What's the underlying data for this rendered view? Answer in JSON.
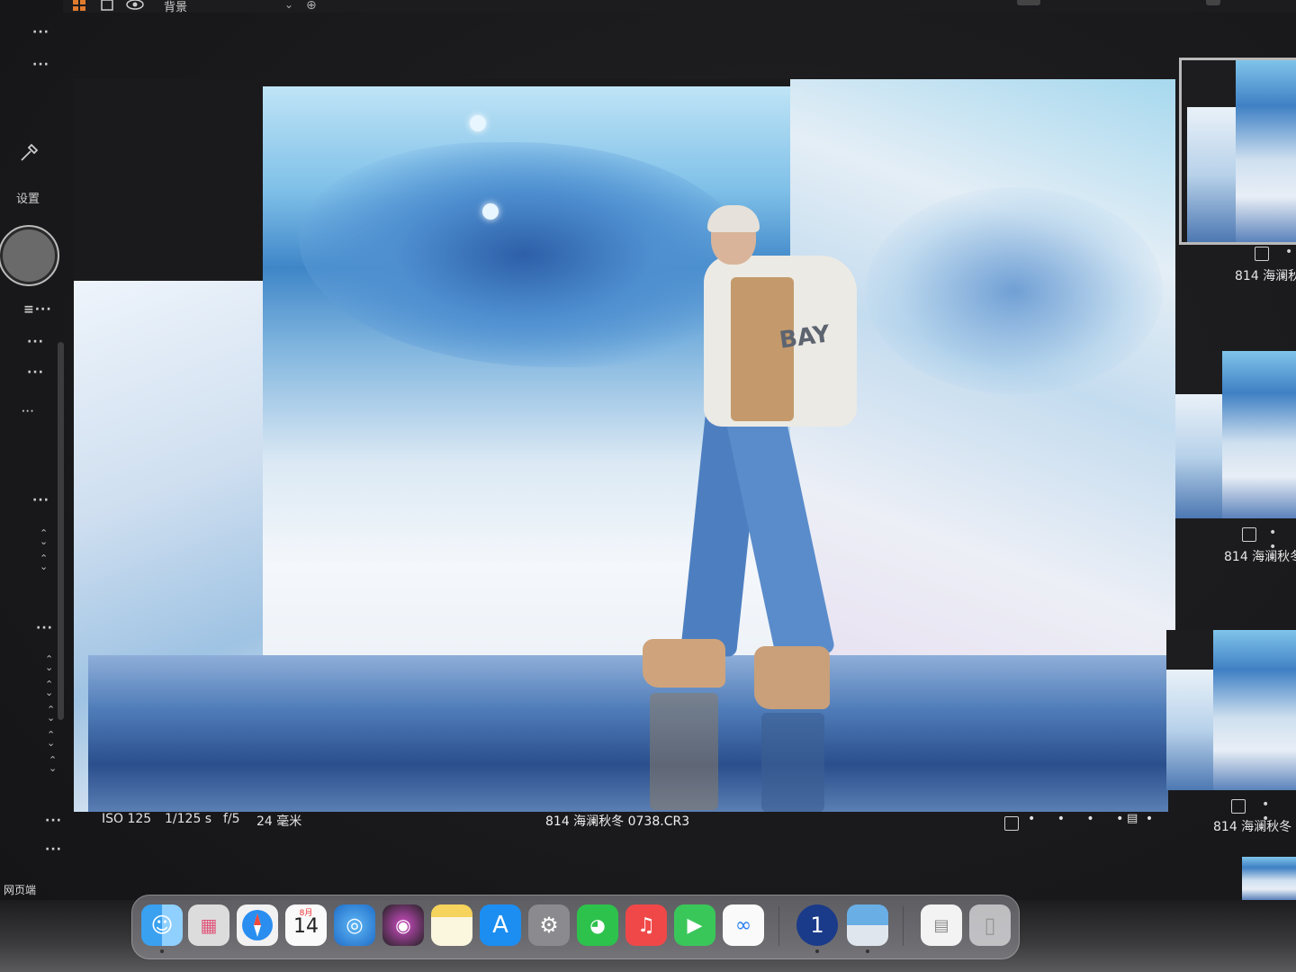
{
  "topbar": {
    "label": "背景"
  },
  "left_panel": {
    "settings_label": "设置",
    "web_label": "网页端"
  },
  "photo_info": {
    "iso": "ISO 125",
    "shutter": "1/125 s",
    "aperture": "f/5",
    "focal_length": "24 毫米",
    "filename": "814 海澜秋冬 0738.CR3",
    "rating_dots": "• • • • •"
  },
  "photo": {
    "jacket_text": "BAY"
  },
  "filmstrip": {
    "thumbs": [
      {
        "label": "814 海澜秋",
        "selected": true
      },
      {
        "label": "814 海澜秋冬",
        "selected": false
      },
      {
        "label": "814 海澜秋冬",
        "selected": false
      }
    ]
  },
  "dock": {
    "calendar_month": "8月",
    "calendar_day": "14",
    "apps": [
      "finder-icon",
      "launchpad-icon",
      "safari-icon",
      "calendar-icon",
      "preview-icon",
      "siri-icon",
      "notes-icon",
      "app-store-icon",
      "system-settings-icon",
      "wechat-icon",
      "netease-music-icon",
      "facetime-icon",
      "baidu-netdisk-icon",
      "1password-icon",
      "photo-import-icon",
      "document-icon",
      "trash-icon"
    ]
  },
  "colors": {
    "accent": "#4a90d9",
    "panel_bg": "#1c1c1e",
    "photo_sky": "#7fc0e8"
  }
}
